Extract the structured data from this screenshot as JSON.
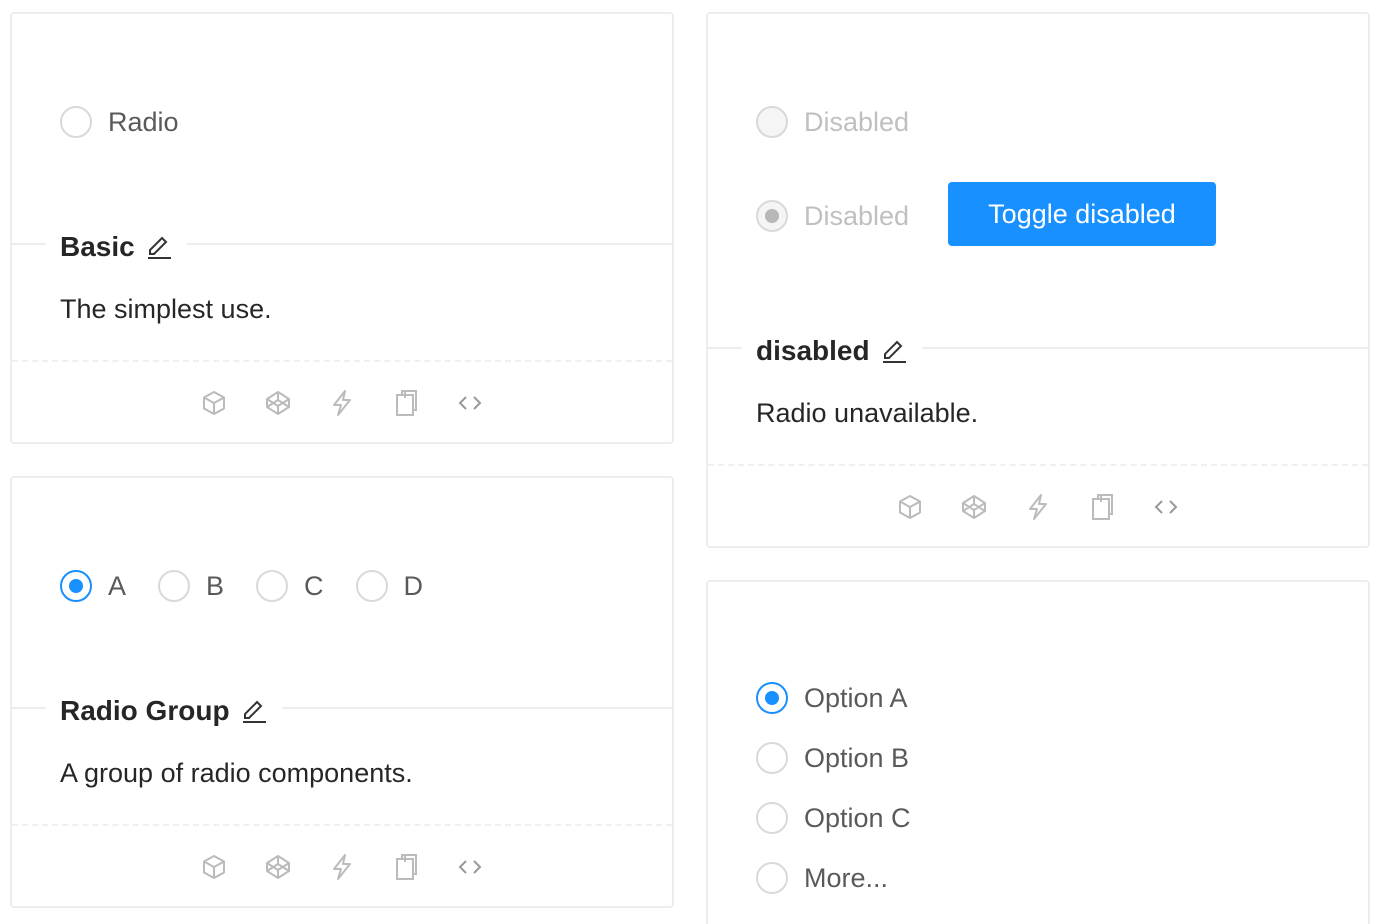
{
  "basic": {
    "radio_label": "Radio",
    "title": "Basic",
    "description": "The simplest use."
  },
  "radio_group": {
    "options": [
      {
        "label": "A",
        "checked": true
      },
      {
        "label": "B",
        "checked": false
      },
      {
        "label": "C",
        "checked": false
      },
      {
        "label": "D",
        "checked": false
      }
    ],
    "title": "Radio Group",
    "description": "A group of radio components."
  },
  "disabled_demo": {
    "radio_1_label": "Disabled",
    "radio_2_label": "Disabled",
    "toggle_button_label": "Toggle disabled",
    "title": "disabled",
    "description": "Radio unavailable."
  },
  "vertical_group": {
    "options": [
      {
        "label": "Option A",
        "checked": true
      },
      {
        "label": "Option B",
        "checked": false
      },
      {
        "label": "Option C",
        "checked": false
      },
      {
        "label": "More...",
        "checked": false
      }
    ]
  },
  "action_icons": [
    "codesandbox-icon",
    "codepen-icon",
    "stackblitz-icon",
    "copy-code-icon",
    "expand-code-icon"
  ],
  "colors": {
    "primary": "#1890ff",
    "border": "#ebedf0"
  }
}
